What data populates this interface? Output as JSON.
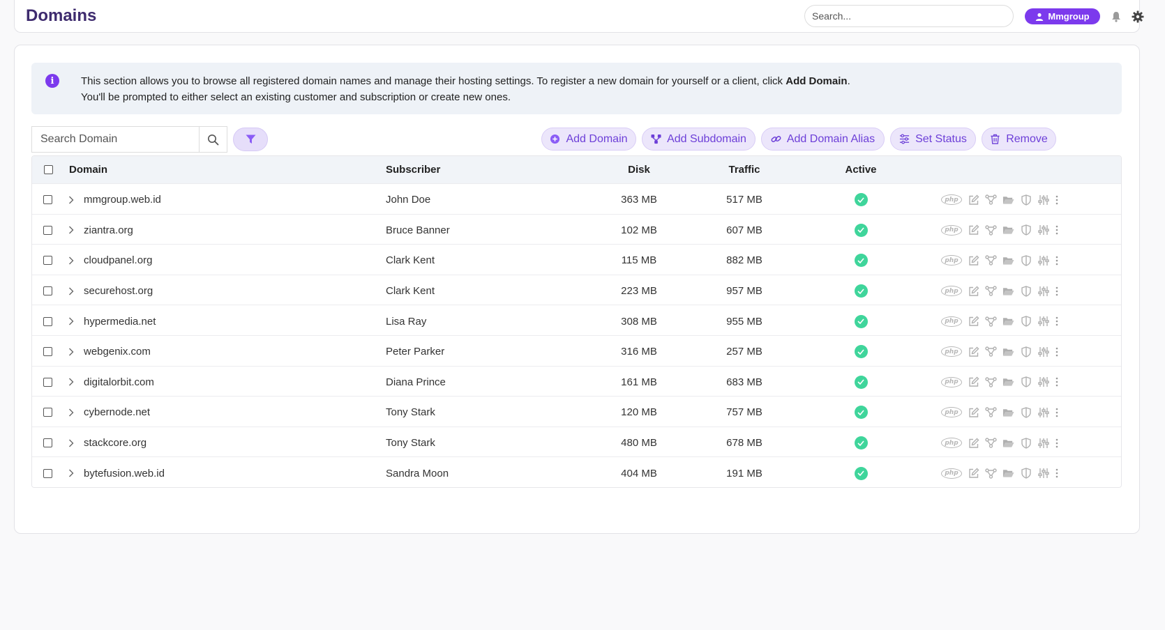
{
  "header": {
    "title": "Domains",
    "search_placeholder": "Search...",
    "user_label": "Mmgroup"
  },
  "info": {
    "text_before": "This section allows you to browse all registered domain names and manage their hosting settings. To register a new domain for yourself or a client, click ",
    "bold": "Add Domain",
    "text_after": ".",
    "line2": "You'll be prompted to either select an existing customer and subscription or create new ones."
  },
  "toolbar": {
    "search_placeholder": "Search Domain",
    "add_domain": "Add Domain",
    "add_subdomain": "Add Subdomain",
    "add_alias": "Add Domain Alias",
    "set_status": "Set Status",
    "remove": "Remove"
  },
  "table": {
    "headers": {
      "domain": "Domain",
      "subscriber": "Subscriber",
      "disk": "Disk",
      "traffic": "Traffic",
      "active": "Active"
    },
    "rows": [
      {
        "domain": "mmgroup.web.id",
        "subscriber": "John Doe",
        "disk": "363 MB",
        "traffic": "517 MB",
        "active": true
      },
      {
        "domain": "ziantra.org",
        "subscriber": "Bruce Banner",
        "disk": "102 MB",
        "traffic": "607 MB",
        "active": true
      },
      {
        "domain": "cloudpanel.org",
        "subscriber": "Clark Kent",
        "disk": "115 MB",
        "traffic": "882 MB",
        "active": true
      },
      {
        "domain": "securehost.org",
        "subscriber": "Clark Kent",
        "disk": "223 MB",
        "traffic": "957 MB",
        "active": true
      },
      {
        "domain": "hypermedia.net",
        "subscriber": "Lisa Ray",
        "disk": "308 MB",
        "traffic": "955 MB",
        "active": true
      },
      {
        "domain": "webgenix.com",
        "subscriber": "Peter Parker",
        "disk": "316 MB",
        "traffic": "257 MB",
        "active": true
      },
      {
        "domain": "digitalorbit.com",
        "subscriber": "Diana Prince",
        "disk": "161 MB",
        "traffic": "683 MB",
        "active": true
      },
      {
        "domain": "cybernode.net",
        "subscriber": "Tony Stark",
        "disk": "120 MB",
        "traffic": "757 MB",
        "active": true
      },
      {
        "domain": "stackcore.org",
        "subscriber": "Tony Stark",
        "disk": "480 MB",
        "traffic": "678 MB",
        "active": true
      },
      {
        "domain": "bytefusion.web.id",
        "subscriber": "Sandra Moon",
        "disk": "404 MB",
        "traffic": "191 MB",
        "active": true
      }
    ],
    "row_action_icons": [
      "php-icon",
      "edit-icon",
      "subdomain-icon",
      "folder-icon",
      "shield-icon",
      "settings-sliders-icon",
      "more-vertical-icon"
    ],
    "php_label": "php"
  },
  "colors": {
    "accent": "#7c3aed",
    "title": "#3e2b6e",
    "active": "#3fd59b"
  }
}
